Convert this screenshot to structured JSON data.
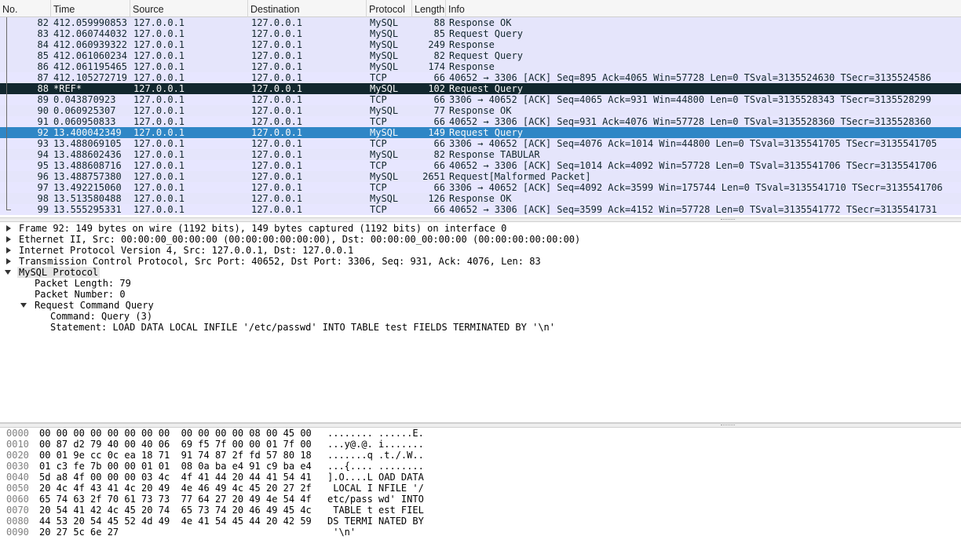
{
  "columns": {
    "no": "No.",
    "time": "Time",
    "source": "Source",
    "destination": "Destination",
    "protocol": "Protocol",
    "length": "Length",
    "info": "Info"
  },
  "packets": [
    {
      "no": "82",
      "time": "412.059990853",
      "src": "127.0.0.1",
      "dst": "127.0.0.1",
      "proto": "MySQL",
      "len": "88",
      "info": "Response OK",
      "style": "mysql"
    },
    {
      "no": "83",
      "time": "412.060744032",
      "src": "127.0.0.1",
      "dst": "127.0.0.1",
      "proto": "MySQL",
      "len": "85",
      "info": "Request Query",
      "style": "mysql"
    },
    {
      "no": "84",
      "time": "412.060939322",
      "src": "127.0.0.1",
      "dst": "127.0.0.1",
      "proto": "MySQL",
      "len": "249",
      "info": "Response",
      "style": "mysql"
    },
    {
      "no": "85",
      "time": "412.061060234",
      "src": "127.0.0.1",
      "dst": "127.0.0.1",
      "proto": "MySQL",
      "len": "82",
      "info": "Request Query",
      "style": "mysql"
    },
    {
      "no": "86",
      "time": "412.061195465",
      "src": "127.0.0.1",
      "dst": "127.0.0.1",
      "proto": "MySQL",
      "len": "174",
      "info": "Response",
      "style": "mysql"
    },
    {
      "no": "87",
      "time": "412.105272719",
      "src": "127.0.0.1",
      "dst": "127.0.0.1",
      "proto": "TCP",
      "len": "66",
      "info": "40652 → 3306 [ACK] Seq=895 Ack=4065 Win=57728 Len=0 TSval=3135524630 TSecr=3135524586",
      "style": "tcp"
    },
    {
      "no": "88",
      "time": "*REF*",
      "src": "127.0.0.1",
      "dst": "127.0.0.1",
      "proto": "MySQL",
      "len": "102",
      "info": "Request Query",
      "style": "ref"
    },
    {
      "no": "89",
      "time": "0.043870923",
      "src": "127.0.0.1",
      "dst": "127.0.0.1",
      "proto": "TCP",
      "len": "66",
      "info": "3306 → 40652 [ACK] Seq=4065 Ack=931 Win=44800 Len=0 TSval=3135528343 TSecr=3135528299",
      "style": "tcp"
    },
    {
      "no": "90",
      "time": "0.060925307",
      "src": "127.0.0.1",
      "dst": "127.0.0.1",
      "proto": "MySQL",
      "len": "77",
      "info": "Response OK",
      "style": "mysql"
    },
    {
      "no": "91",
      "time": "0.060950833",
      "src": "127.0.0.1",
      "dst": "127.0.0.1",
      "proto": "TCP",
      "len": "66",
      "info": "40652 → 3306 [ACK] Seq=931 Ack=4076 Win=57728 Len=0 TSval=3135528360 TSecr=3135528360",
      "style": "tcp"
    },
    {
      "no": "92",
      "time": "13.400042349",
      "src": "127.0.0.1",
      "dst": "127.0.0.1",
      "proto": "MySQL",
      "len": "149",
      "info": "Request Query",
      "style": "sel"
    },
    {
      "no": "93",
      "time": "13.488069105",
      "src": "127.0.0.1",
      "dst": "127.0.0.1",
      "proto": "TCP",
      "len": "66",
      "info": "3306 → 40652 [ACK] Seq=4076 Ack=1014 Win=44800 Len=0 TSval=3135541705 TSecr=3135541705",
      "style": "tcp"
    },
    {
      "no": "94",
      "time": "13.488602436",
      "src": "127.0.0.1",
      "dst": "127.0.0.1",
      "proto": "MySQL",
      "len": "82",
      "info": "Response TABULAR",
      "style": "mysql"
    },
    {
      "no": "95",
      "time": "13.488608716",
      "src": "127.0.0.1",
      "dst": "127.0.0.1",
      "proto": "TCP",
      "len": "66",
      "info": "40652 → 3306 [ACK] Seq=1014 Ack=4092 Win=57728 Len=0 TSval=3135541706 TSecr=3135541706",
      "style": "tcp"
    },
    {
      "no": "96",
      "time": "13.488757380",
      "src": "127.0.0.1",
      "dst": "127.0.0.1",
      "proto": "MySQL",
      "len": "2651",
      "info": "Request[Malformed Packet]",
      "style": "mysql"
    },
    {
      "no": "97",
      "time": "13.492215060",
      "src": "127.0.0.1",
      "dst": "127.0.0.1",
      "proto": "TCP",
      "len": "66",
      "info": "3306 → 40652 [ACK] Seq=4092 Ack=3599 Win=175744 Len=0 TSval=3135541710 TSecr=3135541706",
      "style": "tcp"
    },
    {
      "no": "98",
      "time": "13.513580488",
      "src": "127.0.0.1",
      "dst": "127.0.0.1",
      "proto": "MySQL",
      "len": "126",
      "info": "Response OK",
      "style": "mysql"
    },
    {
      "no": "99",
      "time": "13.555295331",
      "src": "127.0.0.1",
      "dst": "127.0.0.1",
      "proto": "TCP",
      "len": "66",
      "info": "40652 → 3306 [ACK] Seq=3599 Ack=4152 Win=57728 Len=0 TSval=3135541772 TSecr=3135541731",
      "style": "tcp"
    }
  ],
  "details": {
    "frame": "Frame 92: 149 bytes on wire (1192 bits), 149 bytes captured (1192 bits) on interface 0",
    "ethernet": "Ethernet II, Src: 00:00:00_00:00:00 (00:00:00:00:00:00), Dst: 00:00:00_00:00:00 (00:00:00:00:00:00)",
    "ip": "Internet Protocol Version 4, Src: 127.0.0.1, Dst: 127.0.0.1",
    "tcp": "Transmission Control Protocol, Src Port: 40652, Dst Port: 3306, Seq: 931, Ack: 4076, Len: 83",
    "mysql": "MySQL Protocol",
    "packet_length": "Packet Length: 79",
    "packet_number": "Packet Number: 0",
    "request_command": "Request Command Query",
    "command": "Command: Query (3)",
    "statement": "Statement: LOAD DATA LOCAL INFILE '/etc/passwd' INTO TABLE test FIELDS TERMINATED BY '\\n'"
  },
  "bytes": [
    {
      "offset": "0000",
      "hex": "00 00 00 00 00 00 00 00  00 00 00 00 08 00 45 00",
      "ascii": "........ ......E."
    },
    {
      "offset": "0010",
      "hex": "00 87 d2 79 40 00 40 06  69 f5 7f 00 00 01 7f 00",
      "ascii": "...y@.@. i......."
    },
    {
      "offset": "0020",
      "hex": "00 01 9e cc 0c ea 18 71  91 74 87 2f fd 57 80 18",
      "ascii": ".......q .t./.W.."
    },
    {
      "offset": "0030",
      "hex": "01 c3 fe 7b 00 00 01 01  08 0a ba e4 91 c9 ba e4",
      "ascii": "...{.... ........"
    },
    {
      "offset": "0040",
      "hex": "5d a8 4f 00 00 00 03 4c  4f 41 44 20 44 41 54 41",
      "ascii": "].O....L OAD DATA"
    },
    {
      "offset": "0050",
      "hex": "20 4c 4f 43 41 4c 20 49  4e 46 49 4c 45 20 27 2f",
      "ascii": " LOCAL I NFILE '/"
    },
    {
      "offset": "0060",
      "hex": "65 74 63 2f 70 61 73 73  77 64 27 20 49 4e 54 4f",
      "ascii": "etc/pass wd' INTO"
    },
    {
      "offset": "0070",
      "hex": "20 54 41 42 4c 45 20 74  65 73 74 20 46 49 45 4c",
      "ascii": " TABLE t est FIEL"
    },
    {
      "offset": "0080",
      "hex": "44 53 20 54 45 52 4d 49  4e 41 54 45 44 20 42 59",
      "ascii": "DS TERMI NATED BY"
    },
    {
      "offset": "0090",
      "hex": "20 27 5c 6e 27",
      "ascii": " '\\n'"
    }
  ],
  "colors": {
    "mysql_row": "#e5e5fb",
    "tcp_row": "#e7e6ff",
    "ref_row": "#12272e",
    "selected_row": "#2f86c6"
  }
}
